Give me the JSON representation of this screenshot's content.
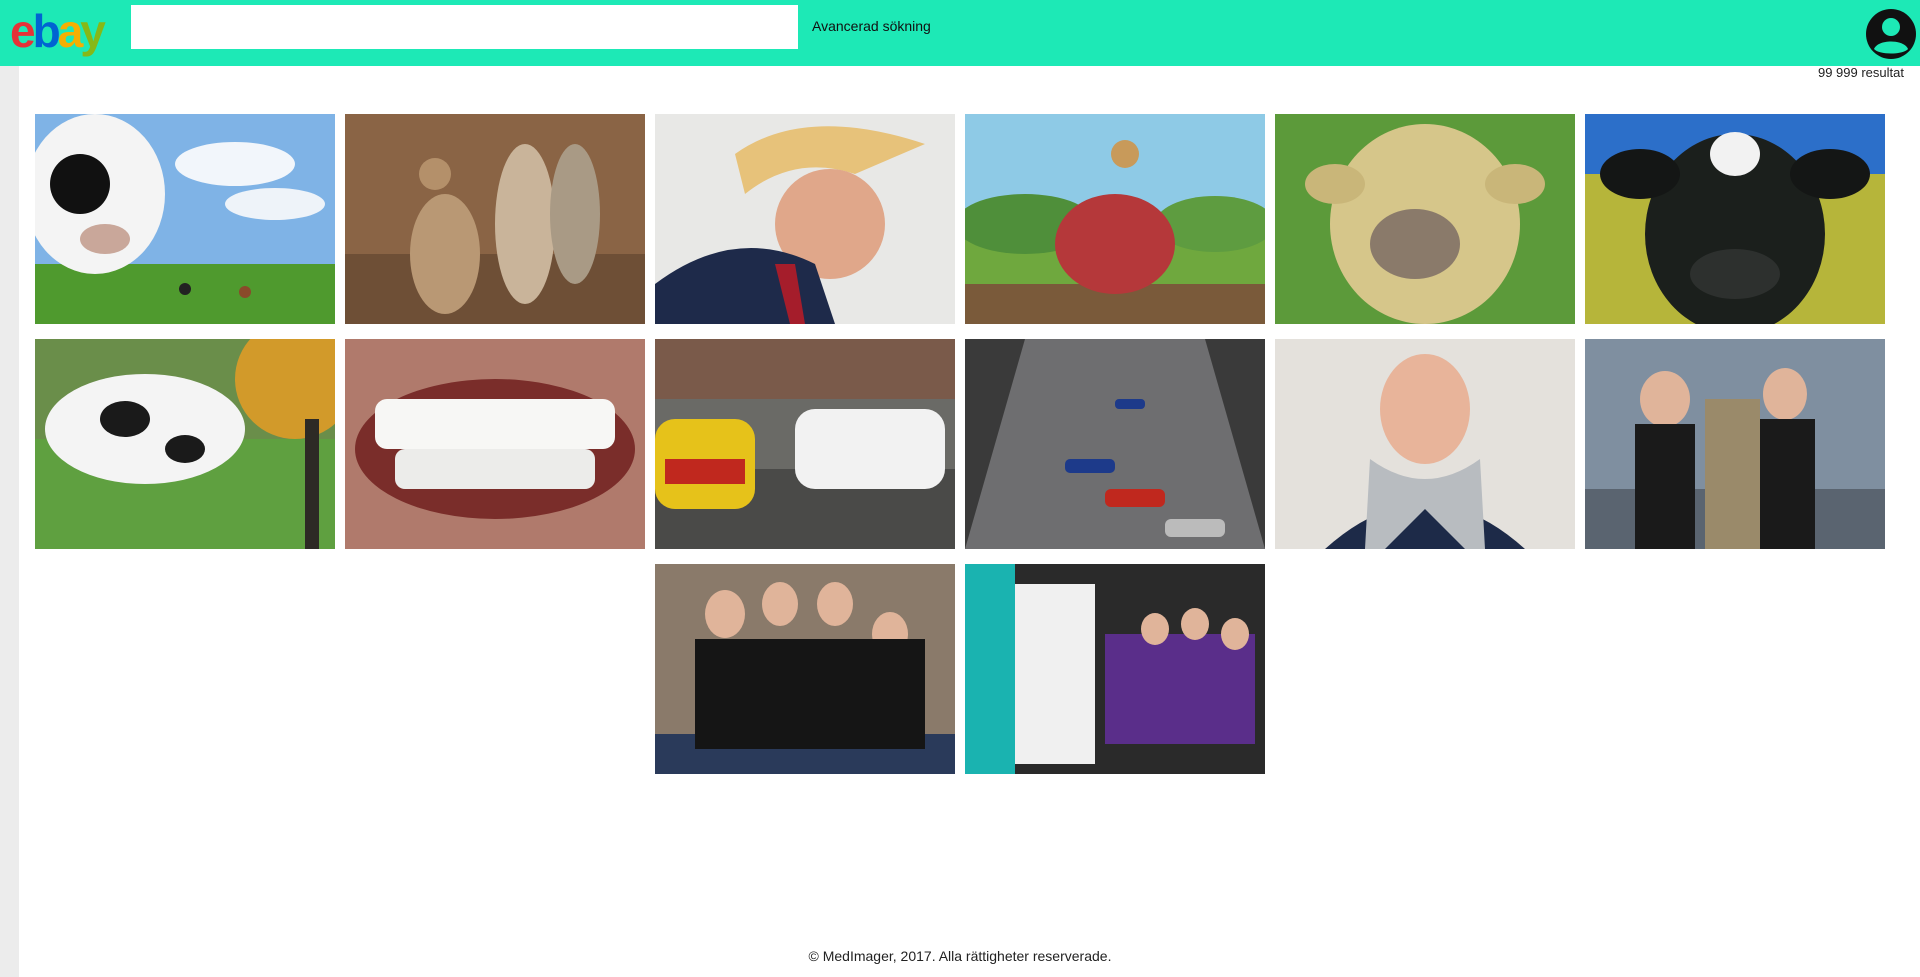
{
  "header": {
    "logo_letters": [
      {
        "char": "e",
        "color": "#e53238"
      },
      {
        "char": "b",
        "color": "#0064d2"
      },
      {
        "char": "a",
        "color": "#f5af02"
      },
      {
        "char": "y",
        "color": "#86b817"
      }
    ],
    "search": {
      "value": "",
      "placeholder": ""
    },
    "advanced_search_label": "Avancerad sökning",
    "avatar_icon": "account-circle-icon"
  },
  "results": {
    "count_label": "99 999 resultat",
    "images": [
      {
        "subject": "cow-closeup-field"
      },
      {
        "subject": "meerkats"
      },
      {
        "subject": "man-profile"
      },
      {
        "subject": "cartoon-warthog"
      },
      {
        "subject": "brown-cow"
      },
      {
        "subject": "black-white-cow-face"
      },
      {
        "subject": "cow-with-woman"
      },
      {
        "subject": "teeth-smile"
      },
      {
        "subject": "rally-cars"
      },
      {
        "subject": "formula-one-race"
      },
      {
        "subject": "man-scarf"
      },
      {
        "subject": "group-on-pier"
      },
      {
        "subject": "team-group-indoors"
      },
      {
        "subject": "chalmers-booth-group"
      }
    ]
  },
  "footer": {
    "copyright": "© MedImager, 2017. Alla rättigheter reserverade."
  }
}
